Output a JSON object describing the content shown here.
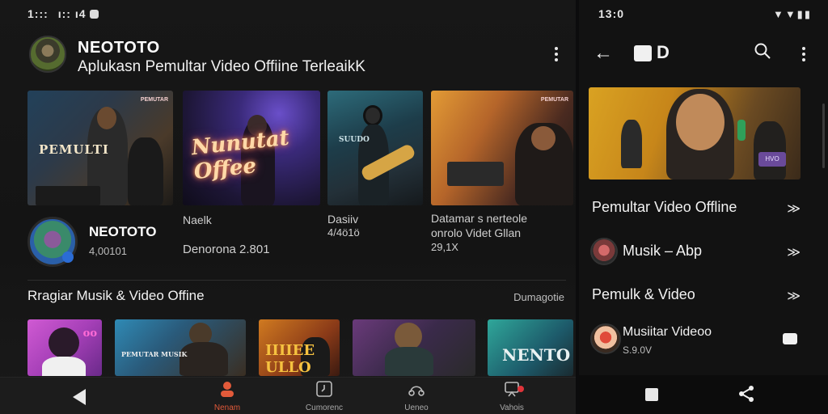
{
  "left": {
    "status_time": "1:::⠀ı:: ı4",
    "channel": {
      "name": "NEOTOTO",
      "subtitle": "Aplukasn Pemultar Video Offiine TerleaikK"
    },
    "thumbnails": [
      {
        "overlay_text": "PEMULTI",
        "badge": "PEMUTAR"
      },
      {
        "overlay_text": "Nunutat Offee",
        "badge": ""
      },
      {
        "overlay_text": "SUUDO",
        "badge": ""
      },
      {
        "overlay_text": "",
        "badge": "PEMUTAR"
      }
    ],
    "meta": {
      "title": "NEOTOTO",
      "count": "4,00101",
      "col2_line1": "Naelk",
      "col2_line2": "Denorona 2.801",
      "col3_line1": "Dasiiv",
      "col3_line2": "4/4ö1ö",
      "col4_line1": "Datamar  s  nerteole",
      "col4_line2": "onrolo  Videt Gllan",
      "col4_line3": "29,1X"
    },
    "section": {
      "title": "Rragiar Musik & Video Offine",
      "link": "Dumagotie"
    },
    "strip": [
      {
        "overlay_text": "oo"
      },
      {
        "overlay_text": "PEMUTAR MUSIK"
      },
      {
        "overlay_text": "IIIIEE ULLO"
      },
      {
        "overlay_text": ""
      },
      {
        "overlay_text": "NENTO"
      }
    ],
    "bottom_nav": [
      {
        "label": "Nenam",
        "icon": "person-icon",
        "active": true
      },
      {
        "label": "Cumorenc",
        "icon": "clock-icon",
        "active": false
      },
      {
        "label": "Ueneo",
        "icon": "headphones-icon",
        "active": false
      },
      {
        "label": "Vahois",
        "icon": "profile-notification-icon",
        "active": false
      }
    ],
    "colors": {
      "accent": "#e25a3a",
      "background": "#141414"
    }
  },
  "right": {
    "status_time": "13:0",
    "status_icons": "▼▼▮▮",
    "rows": [
      {
        "label": "Pemultar Video Offline",
        "chevron": "≫"
      },
      {
        "label": "Musik – Abp",
        "chevron": "≫"
      },
      {
        "label": "Pemulk & Video",
        "chevron": "≫"
      },
      {
        "label": "Musiitar Videoo",
        "sub": "S.9.0V"
      }
    ],
    "hero_badge": "HVO"
  }
}
